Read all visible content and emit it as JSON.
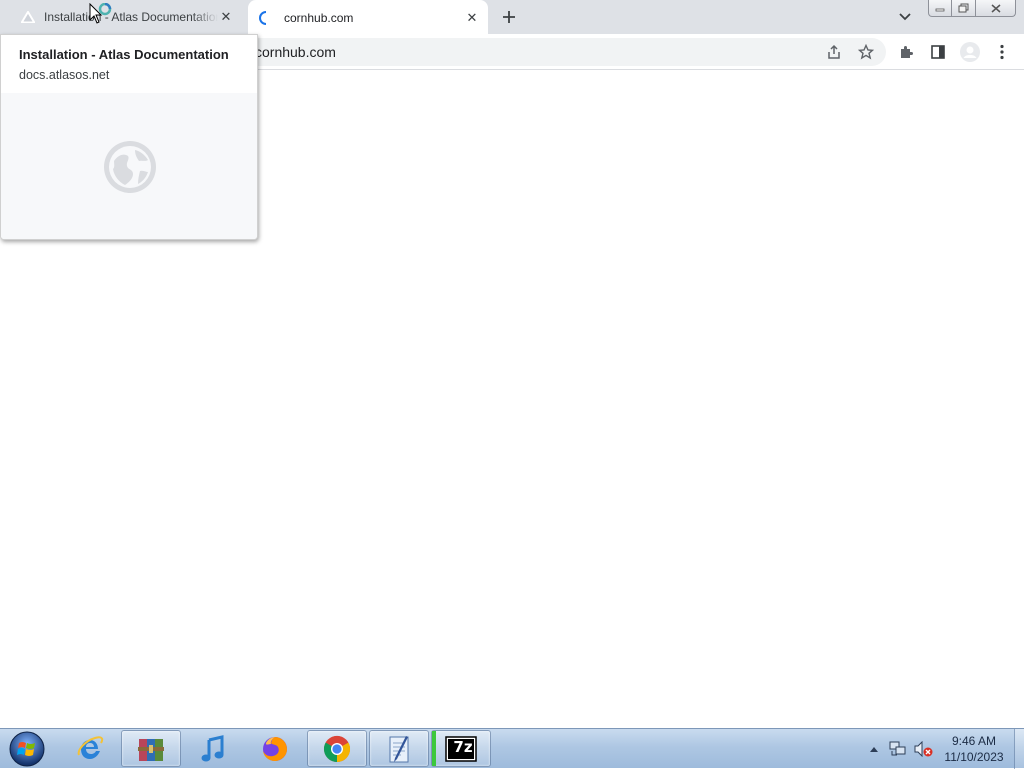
{
  "browser": {
    "tabs": [
      {
        "title": "Installation - Atlas Documentation",
        "favicon": "atlas-triangle-icon",
        "active": false
      },
      {
        "title": "cornhub.com",
        "favicon": "loading-spinner-icon",
        "active": true
      }
    ],
    "new_tab_icon": "plus-icon",
    "tab_search_icon": "chevron-down-icon",
    "window_controls": [
      "minimize-icon",
      "restore-icon",
      "close-icon"
    ],
    "address_bar": {
      "url": "cornhub.com"
    },
    "toolbar_icons": [
      "share-icon",
      "star-icon",
      "extensions-icon",
      "side-panel-icon",
      "profile-icon",
      "more-menu-icon"
    ]
  },
  "hover_card": {
    "title": "Installation - Atlas Documentation",
    "domain": "docs.atlasos.net",
    "preview_icon": "globe-icon"
  },
  "taskbar": {
    "start_icon": "windows-orb-icon",
    "apps": [
      {
        "name": "internet-explorer-icon",
        "pinned": false
      },
      {
        "name": "winrar-icon",
        "pinned": true
      },
      {
        "name": "itunes-icon",
        "pinned": false
      },
      {
        "name": "firefox-icon",
        "pinned": false
      },
      {
        "name": "chrome-icon",
        "pinned": true
      },
      {
        "name": "notepad-icon",
        "pinned": true
      },
      {
        "name": "7zip-icon",
        "pinned": true,
        "label": "7z"
      }
    ],
    "tray_icons": [
      "show-hidden-icons-arrow",
      "network-icon",
      "volume-muted-icon"
    ],
    "clock": {
      "time": "9:46 AM",
      "date": "11/10/2023"
    }
  },
  "colors": {
    "tabstrip": "#dee1e6",
    "omnibox": "#f1f3f4",
    "taskbar": "#aec7e3",
    "spinner": "#1a73e8"
  }
}
